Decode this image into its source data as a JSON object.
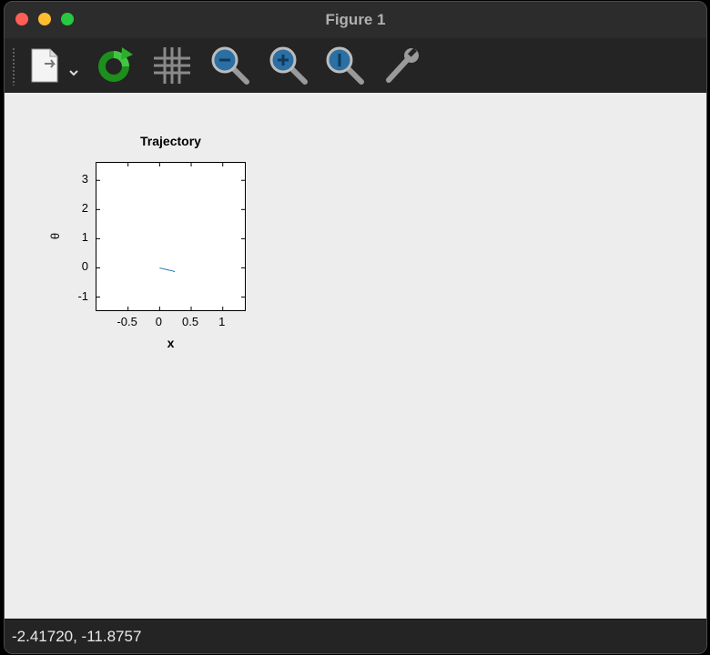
{
  "window": {
    "title": "Figure 1"
  },
  "toolbar": {
    "items": [
      {
        "icon": "save-document-icon"
      },
      {
        "icon": "refresh-icon"
      },
      {
        "icon": "grid-icon"
      },
      {
        "icon": "zoom-out-icon"
      },
      {
        "icon": "zoom-in-icon"
      },
      {
        "icon": "zoom-autoscale-icon"
      },
      {
        "icon": "settings-wrench-icon"
      }
    ]
  },
  "status": {
    "coordinates": "-2.41720, -11.8757"
  },
  "chart_data": {
    "type": "line",
    "title": "Trajectory",
    "xlabel": "x",
    "ylabel": "θ",
    "xlim": [
      -1.0,
      1.35
    ],
    "ylim": [
      -1.45,
      3.6
    ],
    "xticks": [
      -0.5,
      0,
      0.5,
      1
    ],
    "xtick_labels": [
      "-0.5",
      "0",
      "0.5",
      "1"
    ],
    "yticks": [
      -1,
      0,
      1,
      2,
      3
    ],
    "ytick_labels": [
      "-1",
      "0",
      "1",
      "2",
      "3"
    ],
    "grid": false,
    "series": [
      {
        "color": "#1f77b4",
        "x": [
          0.0,
          0.05,
          0.1,
          0.15,
          0.2,
          0.24
        ],
        "y": [
          0.0,
          -0.03,
          -0.05,
          -0.08,
          -0.1,
          -0.13
        ]
      }
    ]
  }
}
